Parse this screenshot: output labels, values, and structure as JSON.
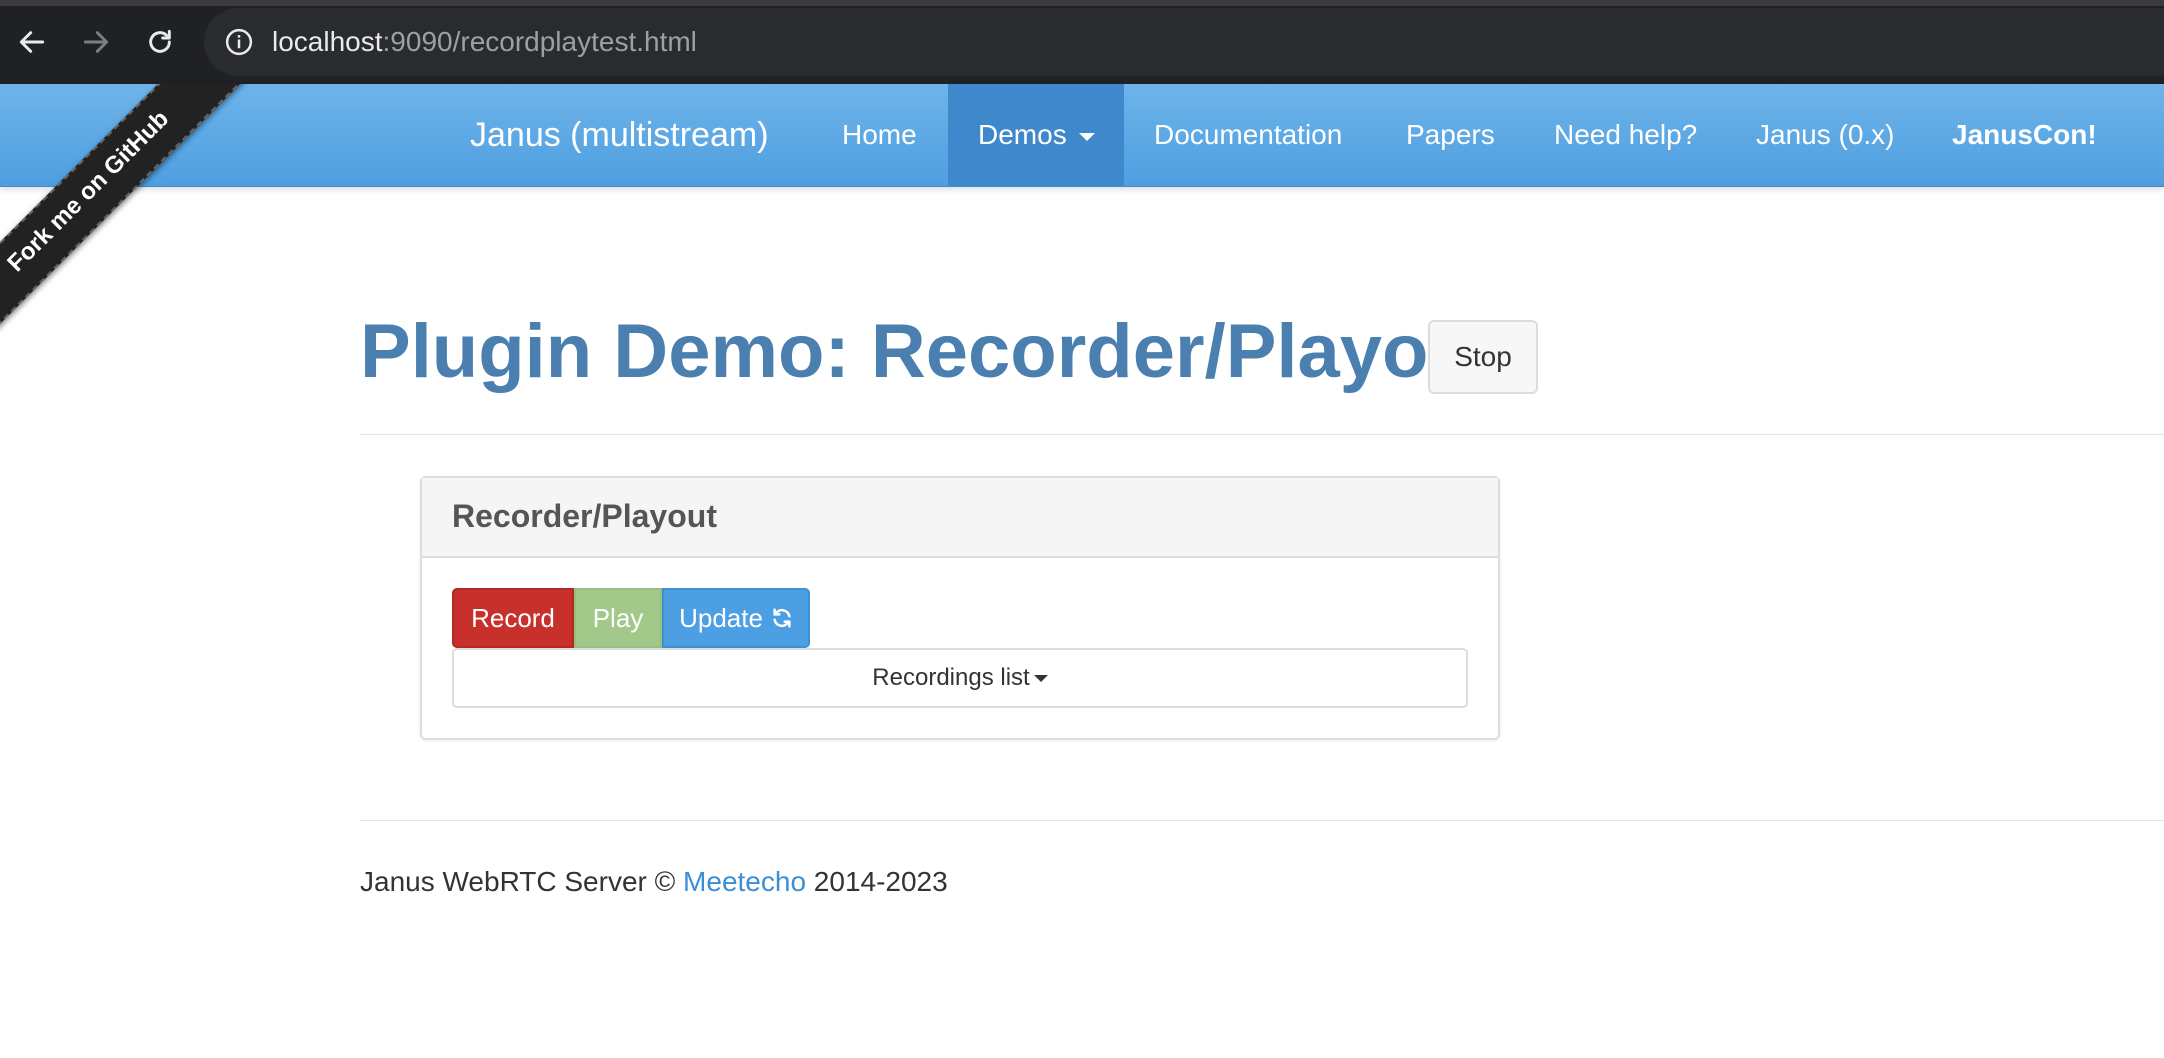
{
  "browser": {
    "url_host": "localhost",
    "url_path": ":9090/recordplaytest.html"
  },
  "navbar": {
    "brand": "Janus (multistream)",
    "items": [
      {
        "label": "Home"
      },
      {
        "label": "Demos"
      },
      {
        "label": "Documentation"
      },
      {
        "label": "Papers"
      },
      {
        "label": "Need help?"
      },
      {
        "label": "Janus (0.x)"
      },
      {
        "label": "JanusCon!"
      }
    ],
    "colors": {
      "background": "#5aa7e4",
      "active": "#3f88cc"
    }
  },
  "ribbon": {
    "text": "Fork me on GitHub"
  },
  "header": {
    "title": "Plugin Demo: Recorder/Playout",
    "stop_label": "Stop",
    "title_color": "#4a7fb0"
  },
  "panel": {
    "title": "Recorder/Playout",
    "record_label": "Record",
    "play_label": "Play",
    "update_label": "Update",
    "recordings_label": "Recordings list",
    "colors": {
      "record": "#c8302b",
      "play": "#a3c98a",
      "update": "#4d9fe3"
    }
  },
  "footer": {
    "prefix": "Janus WebRTC Server ©",
    "link": "Meetecho",
    "suffix": "2014-2023"
  }
}
